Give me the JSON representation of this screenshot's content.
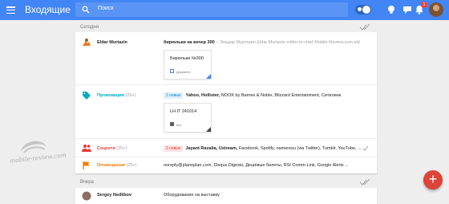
{
  "app": {
    "title": "Входящие",
    "accent": "#4285f4",
    "fab_color": "#db4437"
  },
  "search": {
    "placeholder": "Поиск"
  },
  "topbar": {
    "notification_count": "1"
  },
  "sections": {
    "today": "Сегодня",
    "yesterday": "Вчера"
  },
  "rows": [
    {
      "sender": "Eldar Murtazin",
      "subject": "бирюльки на вечер 300",
      "snippet": " – Эльдар Муртазин Eldar Murtazin editor-in-chief Mobile-Review.com eld",
      "attachment": {
        "title": "Бирюльки №300",
        "type": "Документ"
      }
    },
    {
      "sender": "Промоакции",
      "count": "(25+)",
      "tag": "2 новых",
      "subject_bold": "Yahoo, Hollister,",
      "subject": " NOOK by Barnes & Noble, Blizzard Entertainment, Ситилинк",
      "attachment": {
        "title": "LH IT 241014",
        "type": "doc"
      }
    },
    {
      "sender": "Соцсети",
      "count": "(25+)",
      "tag": "2 новых",
      "subject_bold": "Jayant Ravalia, Ustream,",
      "subject": " Facebook, Spotify, nameresu (via Twitter), Tumblr, YouTube, ..."
    },
    {
      "sender": "Оповещения",
      "count": "(25+)",
      "subject": "noreply@planoplan.com, Disqus Digests, Дешёвые билеты, RSI Comm-Link, Google Alerts ..."
    },
    {
      "sender": "Sergey Nedlibov",
      "subject": "Оборудование на выставку"
    }
  ],
  "watermark": {
    "text": "mobile-review.com"
  }
}
